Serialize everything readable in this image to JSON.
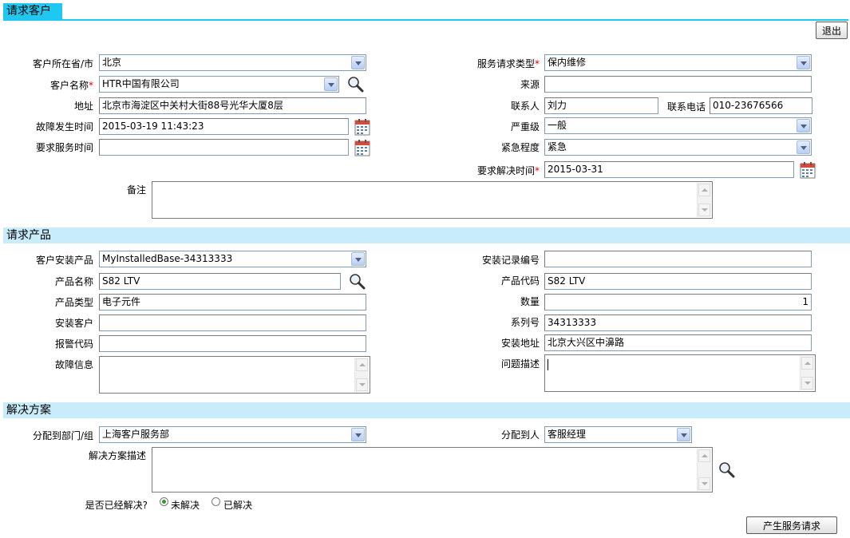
{
  "sections": {
    "customer": "请求客户",
    "product": "请求产品",
    "solution": "解决方案"
  },
  "buttons": {
    "exit": "退出",
    "create": "产生服务请求"
  },
  "customer": {
    "province_label": "客户所在省/市",
    "province_value": "北京",
    "name_label": "客户名称",
    "name_value": "HTR中国有限公司",
    "address_label": "地址",
    "address_value": "北京市海淀区中关村大街88号光华大厦8层",
    "fault_time_label": "故障发生时间",
    "fault_time_value": "2015-03-19 11:43:23",
    "request_time_label": "要求服务时间",
    "request_time_value": "",
    "remark_label": "备注",
    "service_type_label": "服务请求类型",
    "service_type_value": "保内维修",
    "source_label": "来源",
    "source_value": "",
    "contact_label": "联系人",
    "contact_value": "刘力",
    "phone_label": "联系电话",
    "phone_value": "010-23676566",
    "severity_label": "严重级",
    "severity_value": "一般",
    "urgency_label": "紧急程度",
    "urgency_value": "紧急",
    "resolve_time_label": "要求解决时间",
    "resolve_time_value": "2015-03-31",
    "required_mark": "*"
  },
  "product": {
    "installed_label": "客户安装产品",
    "installed_value": "MyInstalledBase-34313333",
    "name_label": "产品名称",
    "name_value": "S82 LTV",
    "type_label": "产品类型",
    "type_value": "电子元件",
    "install_customer_label": "安装客户",
    "install_customer_value": "",
    "alarm_code_label": "报警代码",
    "alarm_code_value": "",
    "fault_info_label": "故障信息",
    "record_no_label": "安装记录编号",
    "record_no_value": "",
    "code_label": "产品代码",
    "code_value": "S82 LTV",
    "quantity_label": "数量",
    "quantity_value": "1",
    "serial_label": "系列号",
    "serial_value": "34313333",
    "install_address_label": "安装地址",
    "install_address_value": "北京大兴区中濞路",
    "problem_label": "问题描述"
  },
  "solution": {
    "dept_label": "分配到部门/组",
    "dept_value": "上海客户服务部",
    "assignee_label": "分配到人",
    "assignee_value": "客服经理",
    "desc_label": "解决方案描述",
    "resolved_label": "是否已经解决?",
    "option_unresolved": "未解决",
    "option_resolved": "已解决"
  },
  "icons": {
    "search": "magnifier-icon",
    "calendar": "calendar-icon"
  },
  "colors": {
    "section_head": "#1ec8f0",
    "section_bar": "#c9ecfa",
    "required": "#e00000"
  }
}
